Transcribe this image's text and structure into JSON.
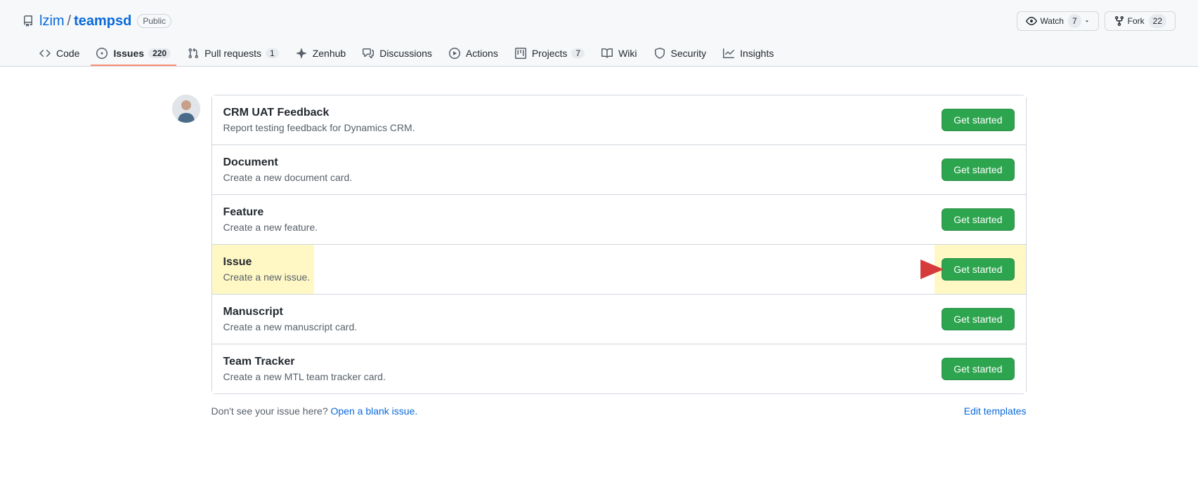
{
  "repo": {
    "owner": "lzim",
    "name": "teampsd",
    "visibility": "Public"
  },
  "actions": {
    "watch": {
      "label": "Watch",
      "count": "7"
    },
    "fork": {
      "label": "Fork",
      "count": "22"
    }
  },
  "tabs": [
    {
      "id": "code",
      "label": "Code",
      "selected": false
    },
    {
      "id": "issues",
      "label": "Issues",
      "count": "220",
      "selected": true
    },
    {
      "id": "pulls",
      "label": "Pull requests",
      "count": "1",
      "selected": false
    },
    {
      "id": "zenhub",
      "label": "Zenhub",
      "selected": false
    },
    {
      "id": "discussions",
      "label": "Discussions",
      "selected": false
    },
    {
      "id": "actions",
      "label": "Actions",
      "selected": false
    },
    {
      "id": "projects",
      "label": "Projects",
      "count": "7",
      "selected": false
    },
    {
      "id": "wiki",
      "label": "Wiki",
      "selected": false
    },
    {
      "id": "security",
      "label": "Security",
      "selected": false
    },
    {
      "id": "insights",
      "label": "Insights",
      "selected": false
    }
  ],
  "templates": [
    {
      "title": "CRM UAT Feedback",
      "desc": "Report testing feedback for Dynamics CRM.",
      "button": "Get started",
      "highlighted": false
    },
    {
      "title": "Document",
      "desc": "Create a new document card.",
      "button": "Get started",
      "highlighted": false
    },
    {
      "title": "Feature",
      "desc": "Create a new feature.",
      "button": "Get started",
      "highlighted": false
    },
    {
      "title": "Issue",
      "desc": "Create a new issue.",
      "button": "Get started",
      "highlighted": true
    },
    {
      "title": "Manuscript",
      "desc": "Create a new manuscript card.",
      "button": "Get started",
      "highlighted": false
    },
    {
      "title": "Team Tracker",
      "desc": "Create a new MTL team tracker card.",
      "button": "Get started",
      "highlighted": false
    }
  ],
  "footer": {
    "prompt": "Don't see your issue here? ",
    "blank_link": "Open a blank issue.",
    "edit_link": "Edit templates"
  },
  "annotation": {
    "arrow_color": "#d73a3a"
  }
}
